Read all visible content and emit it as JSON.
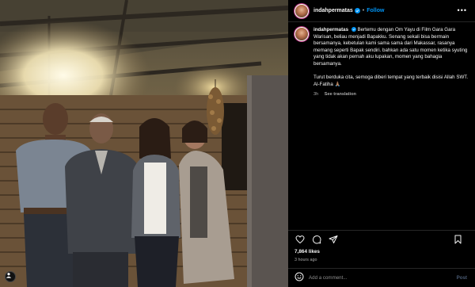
{
  "post": {
    "username": "indahpermatas",
    "follow_label": "Follow",
    "dot_separator": "•",
    "more_label": "•••",
    "verified_icon": "verified-badge-icon"
  },
  "caption": {
    "username": "indahpermatas",
    "paragraph_1": "Bertemu dengan Om Yayu di Film Gara Gara Warisan, beliau menjadi Bapakku. Senang sekali bisa bermain bersamanya, kebetulan kami sama sama dari Makassar, rasanya memang seperti Bapak sendiri. bahkan ada satu momen ketika syuting yang tidak akan pernah aku lupakan, momen yang bahagia bersamanya.",
    "paragraph_2": "Turut berduka cita, semoga diberi tempat yang terbaik disisi Allah SWT.",
    "paragraph_3": "Al-Fatiha 🙏🏽",
    "age": "3h",
    "translate_label": "See translation"
  },
  "actions": {
    "icons": [
      "heart-icon",
      "comment-icon",
      "share-icon",
      "bookmark-icon"
    ]
  },
  "likes": "7,864 likes",
  "time_ago": "3 hours ago",
  "add_comment": {
    "placeholder": "Add a comment...",
    "post_label": "Post",
    "emoji_icon": "emoji-icon"
  },
  "colors": {
    "background": "#000000",
    "accent_blue": "#0095f6",
    "muted_text": "#a8a8a8",
    "divider": "#262626"
  }
}
